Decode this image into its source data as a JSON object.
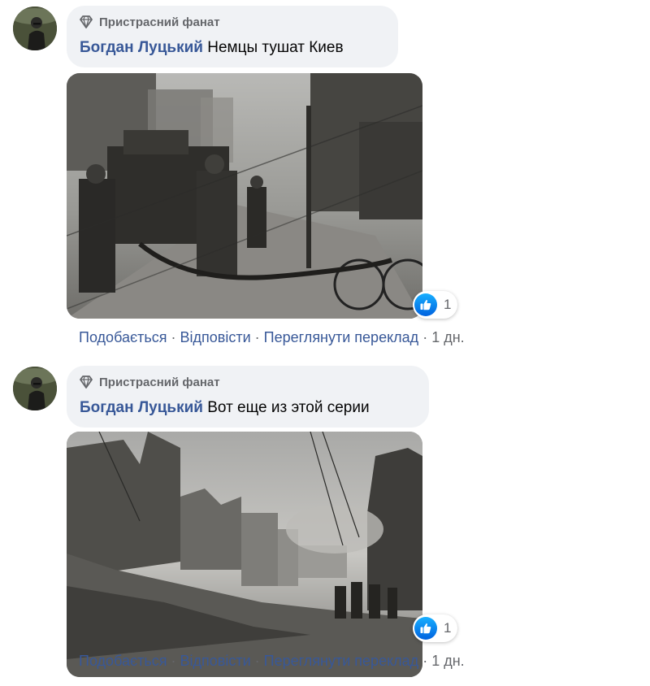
{
  "comments": [
    {
      "badge": "Пристрасний фанат",
      "author": "Богдан Луцький",
      "text": "Немцы тушат Киев",
      "reaction_count": "1",
      "actions": {
        "like": "Подобається",
        "reply": "Відповісти",
        "translate": "Переглянути переклад",
        "time": "1 дн."
      }
    },
    {
      "badge": "Пристрасний фанат",
      "author": "Богдан Луцький",
      "text": "Вот еще из этой серии",
      "reaction_count": "1",
      "actions": {
        "like": "Подобається",
        "reply": "Відповісти",
        "translate": "Переглянути переклад",
        "time": "1 дн."
      }
    }
  ],
  "icons": {
    "badge": "diamond-icon",
    "reaction": "thumbs-up-icon"
  },
  "colors": {
    "author": "#385898",
    "bubble": "#f0f2f5",
    "meta": "#65676b",
    "like_badge": "#1877f2"
  }
}
